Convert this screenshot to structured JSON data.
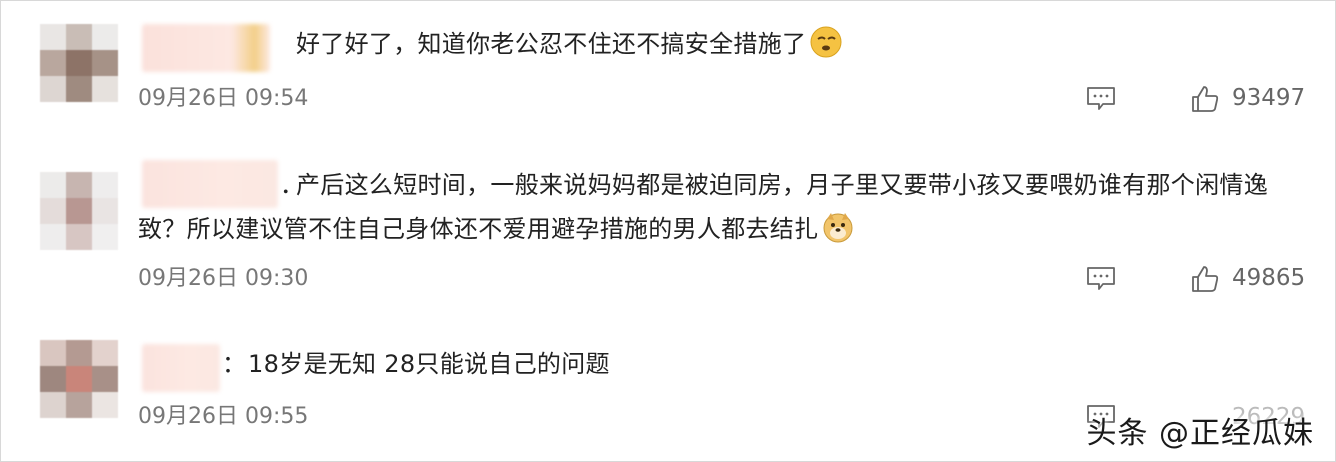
{
  "comments": [
    {
      "text": "好了好了，知道你老公忍不住还不搞安全措施了",
      "emoji": "rolling-eyes-emoji",
      "time": "09月26日 09:54",
      "likes": "93497"
    },
    {
      "separator": "．",
      "text_line1": "产后这么短时间，一般来说妈妈都是被迫同房，月子里又要带小孩又要喂奶谁有那个闲情逸",
      "text_line2": "致？所以建议管不住自己身体还不爱用避孕措施的男人都去结扎",
      "emoji": "doge-emoji",
      "time": "09月26日 09:30",
      "likes": "49865"
    },
    {
      "separator": "：",
      "text": "18岁是无知 28只能说自己的问题",
      "time": "09月26日 09:55",
      "likes": "26229"
    }
  ],
  "watermark": "头条 @正经瓜妹",
  "colors": {
    "text": "#222222",
    "meta": "#777777",
    "icon": "#666666",
    "emoji_fill": "#f5c242"
  }
}
